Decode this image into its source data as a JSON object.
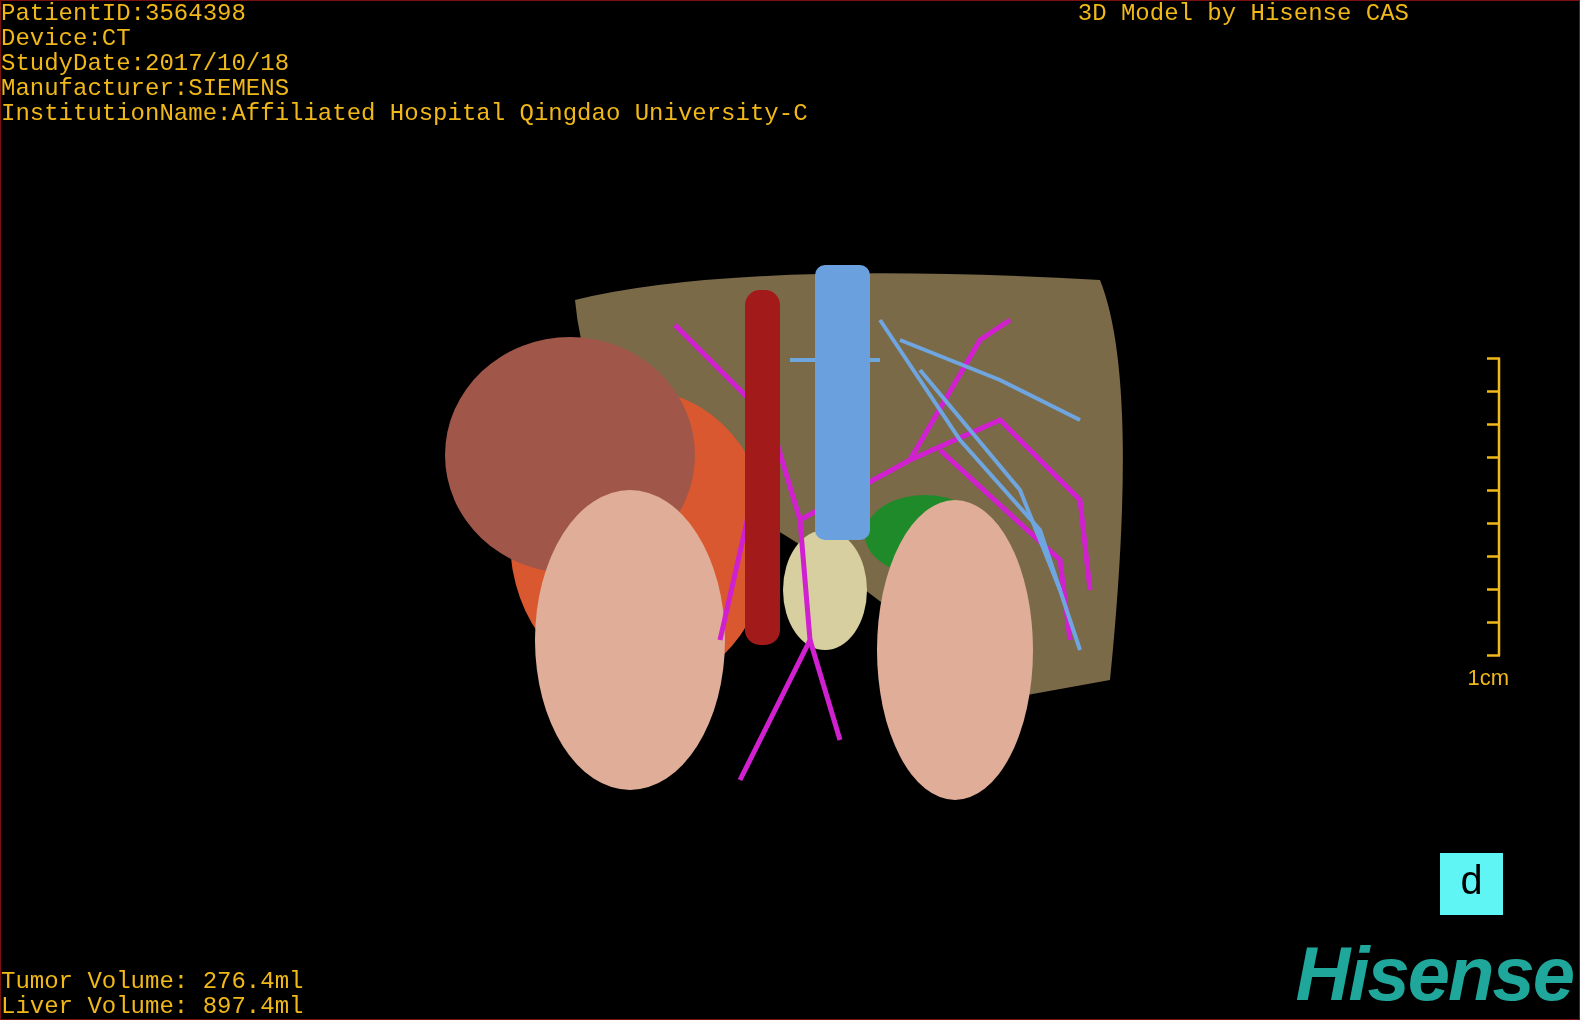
{
  "overlay": {
    "patient_info": [
      "PatientID:3564398",
      "Device:CT",
      "StudyDate:2017/10/18",
      "Manufacturer:SIEMENS",
      "InstitutionName:Affiliated Hospital Qingdao University-C"
    ],
    "title": "3D Model by Hisense CAS",
    "volumes": [
      "Tumor Volume: 276.4ml",
      "Liver Volume: 897.4ml"
    ]
  },
  "scale": {
    "label": "1cm"
  },
  "view_button": {
    "label": "d"
  },
  "logo": "Hisense"
}
